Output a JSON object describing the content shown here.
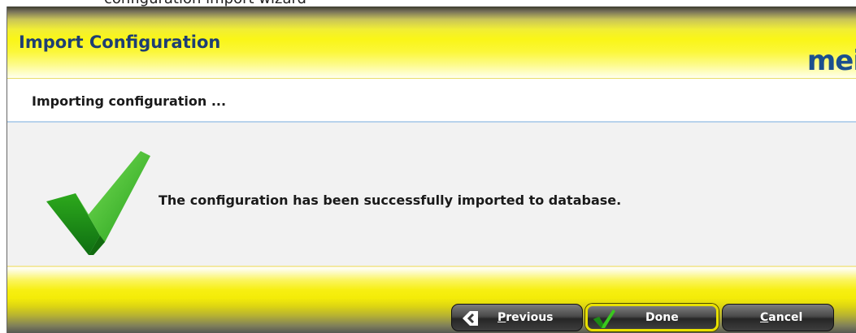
{
  "window": {
    "title": "Import Configuration",
    "brand": "mei",
    "caption_fragment": "configuration import wizard"
  },
  "subheader": {
    "text": "Importing configuration ..."
  },
  "content": {
    "message": "The configuration has been successfully imported to database.",
    "status_icon": "checkmark-icon",
    "status_color": "#2ea81a"
  },
  "footer": {
    "buttons": {
      "previous": {
        "label_first": "P",
        "label_rest": "revious",
        "icon": "back-arrow-icon"
      },
      "done": {
        "label": "Done",
        "icon": "checkmark-icon"
      },
      "cancel": {
        "label_first": "C",
        "label_rest": "ancel"
      }
    }
  },
  "colors": {
    "title_blue": "#1e3e73",
    "header_yellow": "#faf617",
    "button_dark": "#3e3e3e",
    "done_border": "#e8e000"
  }
}
